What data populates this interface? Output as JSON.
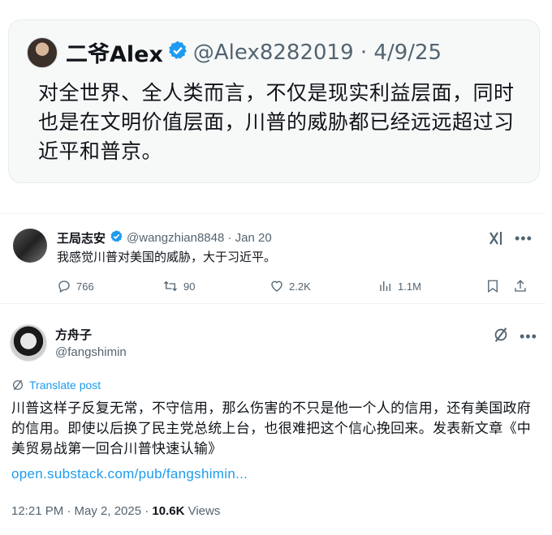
{
  "post1": {
    "name": "二爷Alex",
    "handle_date": "@Alex8282019 · 4/9/25",
    "text": "对全世界、全人类而言，不仅是现实利益层面，同时也是在文明价值层面，川普的威胁都已经远远超过习近平和普京。"
  },
  "post2": {
    "name": "王局志安",
    "handle_date": "@wangzhian8848 · Jan 20",
    "text": "我感觉川普对美国的威胁，大于习近平。",
    "actions": {
      "replies": "766",
      "reposts": "90",
      "likes": "2.2K",
      "views": "1.1M"
    }
  },
  "post3": {
    "name": "方舟子",
    "handle": "@fangshimin",
    "translate": "Translate post",
    "text": "川普这样子反复无常，不守信用，那么伤害的不只是他一个人的信用，还有美国政府的信用。即使以后换了民主党总统上台，也很难把这个信心挽回来。发表新文章《中美贸易战第一回合川普快速认输》",
    "link": "open.substack.com/pub/fangshimin...",
    "timestamp": "12:21 PM · May 2, 2025 · ",
    "views_count": "10.6K",
    "views_label": " Views"
  },
  "colors": {
    "accent_blue": "#1d9bf0",
    "secondary_text": "#536471",
    "card_bg": "#f7f9f9"
  }
}
